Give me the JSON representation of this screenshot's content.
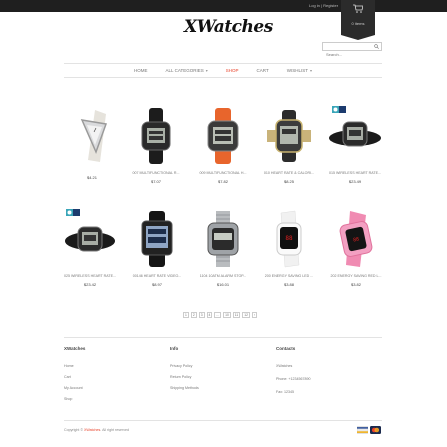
{
  "topbar": {
    "login": "Log in | Register"
  },
  "cart": {
    "count": "0 items"
  },
  "brand": {
    "logo": "XWatches"
  },
  "search": {
    "placeholder": "Search..."
  },
  "nav": [
    {
      "label": "HOME",
      "active": false,
      "dropdown": false
    },
    {
      "label": "All Categories",
      "active": false,
      "dropdown": true
    },
    {
      "label": "SHOP",
      "active": true,
      "dropdown": false
    },
    {
      "label": "CART",
      "active": false,
      "dropdown": false
    },
    {
      "label": "WISHLIST",
      "active": false,
      "dropdown": true
    }
  ],
  "products": [
    {
      "name": "",
      "price": "$4.21",
      "style": "silver-triangle"
    },
    {
      "name": "007 MULTIFUNCTIONAL R...",
      "price": "$7.07",
      "style": "black-sport"
    },
    {
      "name": "009 MULTIFUNCTIONAL H...",
      "price": "$7.82",
      "style": "orange-sport"
    },
    {
      "name": "010 HEART RATE & CALORI...",
      "price": "$8.25",
      "style": "gold-sport"
    },
    {
      "name": "015 WIRELESS HEART RATE...",
      "price": "$23.49",
      "style": "black-chest",
      "badge": true
    },
    {
      "name": "025 WIRELESS HEART RATE...",
      "price": "$23.42",
      "style": "black-chest",
      "badge": true
    },
    {
      "name": "00146 HEART RATE VIDEO...",
      "price": "$8.97",
      "style": "black-square"
    },
    {
      "name": "1104 10ATM ALARM STOP...",
      "price": "$16.01",
      "style": "steel-band"
    },
    {
      "name": "200 ENERGY SAVING LED ...",
      "price": "$3.88",
      "style": "white-led"
    },
    {
      "name": "202 ENERGY SAVING RED L...",
      "price": "$3.82",
      "style": "pink-led"
    }
  ],
  "pagination": [
    "1",
    "2",
    "3",
    "4",
    "...",
    "10",
    "11",
    "12",
    "›"
  ],
  "footer": {
    "col1": {
      "title": "XWatches",
      "links": [
        "Home",
        "Cart",
        "My Account",
        "Shop"
      ]
    },
    "col2": {
      "title": "Info",
      "links": [
        "Privacy Policy",
        "Return Policy",
        "Shipping Methods"
      ]
    },
    "col3": {
      "title": "Contacts",
      "lines": [
        "XWatches",
        "Phone: +1234567890",
        "Fax: 12345"
      ]
    },
    "copyright_prefix": "Copyright ©",
    "copyright_brand": "XWatches",
    "copyright_suffix": ". All right reserved"
  },
  "payments": [
    "visa-card-icon",
    "mastercard-icon"
  ]
}
